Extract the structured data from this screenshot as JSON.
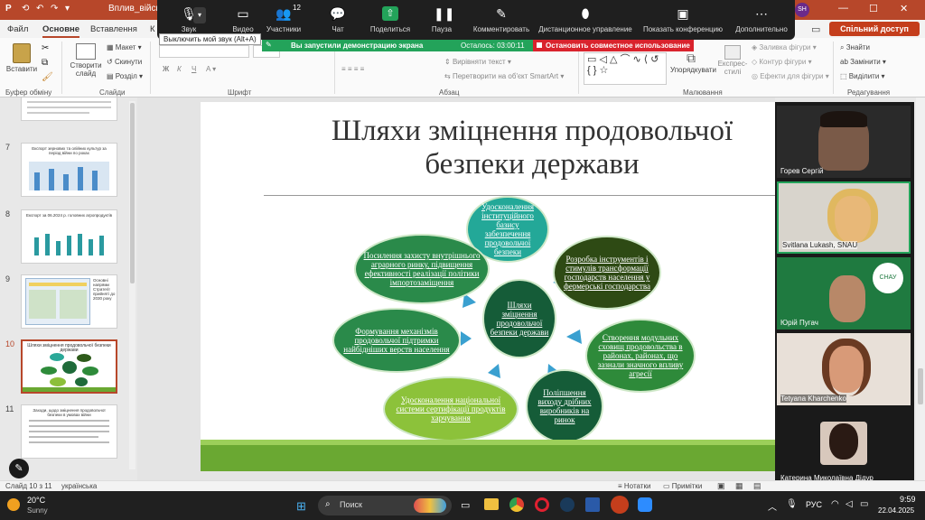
{
  "title_bar": {
    "app_label": "P",
    "doc_name": "Вплив_війсьо...",
    "user_initials": "SH",
    "minimize": "—",
    "maximize": "☐",
    "close": "✕"
  },
  "menu_tabs": [
    "Файл",
    "Основне",
    "Вставлення",
    "К"
  ],
  "share_button": "Спільний доступ",
  "ribbon": {
    "paste": "Вставити",
    "clipboard_group": "Буфер обміну",
    "create_slide": "Створити слайд",
    "layout": "Макет",
    "reset": "Скинути",
    "section": "Розділ",
    "slides_group": "Слайди",
    "font_group": "Шрифт",
    "paragraph_group": "Абзац",
    "align_text": "Вирівняти текст",
    "convert_smartart": "Перетворити на об'єкт SmartArt",
    "arrange": "Упорядкувати",
    "express_styles": "Експрес-стилі",
    "shape_fill": "Заливка фігури",
    "shape_outline": "Контур фігури",
    "shape_effects": "Ефекти для фігури",
    "drawing_group": "Малювання",
    "find": "Знайти",
    "replace": "Замінити",
    "select": "Виділити",
    "editing_group": "Редагування"
  },
  "zoom_toolbar": {
    "buttons": [
      {
        "label": "Звук",
        "icon": "mic-icon"
      },
      {
        "label": "Видео",
        "icon": "video-icon"
      },
      {
        "label": "Участники",
        "icon": "participants-icon",
        "badge": "12"
      },
      {
        "label": "Чат",
        "icon": "chat-icon"
      },
      {
        "label": "Поделиться",
        "icon": "share-icon"
      },
      {
        "label": "Пауза",
        "icon": "pause-icon"
      },
      {
        "label": "Комментировать",
        "icon": "annotate-icon"
      },
      {
        "label": "Дистанционное управление",
        "icon": "mouse-icon"
      },
      {
        "label": "Показать конференцию",
        "icon": "monitor-icon"
      },
      {
        "label": "Дополнительно",
        "icon": "more-icon"
      }
    ],
    "tooltip": "Выключить мой звук (Alt+A)",
    "sharing_text": "Вы запустили демонстрацию экрана",
    "timer": "Осталось: 03:00:11",
    "stop_share": "Остановить совместное использование"
  },
  "slide_pane": {
    "slides": [
      {
        "num": "7",
        "title": "Експорт зернових та олійних культур за період війни по роках"
      },
      {
        "num": "8",
        "title": "Експорт за 06.2024 р. головних агропродуктів"
      },
      {
        "num": "9",
        "title": "Основні напрями Стратегії, прийняті до 2030 року"
      },
      {
        "num": "10",
        "title": "Шляхи зміцнення продовольчої безпеки держави"
      },
      {
        "num": "11",
        "title": "Заходи, щодо зміцнення продовольчої безпеки в умовах війни"
      }
    ],
    "selected": "10",
    "slide9_text": "Основні напрями Стратегії прийняті до 2030 року"
  },
  "slide": {
    "title": "Шляхи зміцнення продовольчої безпеки держави",
    "center": "Шляхи зміцнення продовольчої безпеки держави",
    "nodes": [
      "Удосконалення інституційного базису забезпечення продовольчої безпеки",
      "Розробка інструментів і стимулів трансформації господарств населення у фермерські господарства",
      "Створення модульних сховищ продовольства в районах, районах, що зазнали значного впливу агресії",
      "Поліпшення виходу дрібних виробників на ринок",
      "Удосконалення національної системи сертифікації продуктів харчування",
      "Формування механізмів продовольчої підтримки найбідніших верств населення",
      "Посилення захисту внутрішнього аграрного ринку, підвищення ефективності реалізації політики імпортозаміщення"
    ]
  },
  "videos": [
    "Горев Сергій",
    "Svitlana Lukash, SNAU",
    "Юрій Пугач",
    "Tetyana Kharchenko",
    "Катерина Миколаївна Дідур"
  ],
  "status_bar": {
    "slide_info": "Слайд 10 з 11",
    "language": "українська",
    "notes": "Нотатки",
    "comments": "Примітки"
  },
  "taskbar": {
    "temp": "20°C",
    "weather": "Sunny",
    "search": "Поиск",
    "lang": "РУС",
    "time": "9:59",
    "date": "22.04.2025"
  }
}
